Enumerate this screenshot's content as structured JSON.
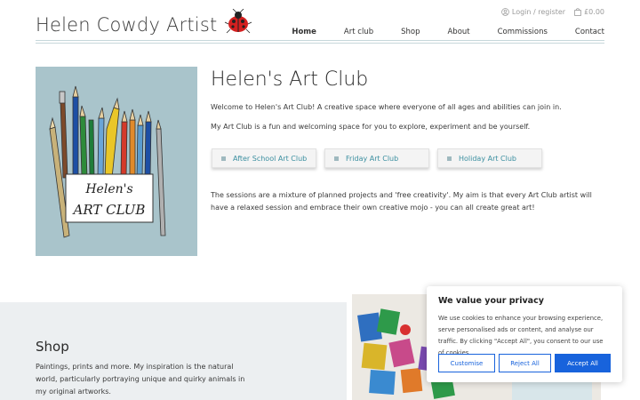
{
  "header": {
    "logo_text": "Helen Cowdy Artist",
    "login_label": "Login / register",
    "cart_label": "£0.00",
    "nav": [
      "Home",
      "Art club",
      "Shop",
      "About",
      "Commissions",
      "Contact"
    ]
  },
  "hero": {
    "image_caption_line1": "Helen's",
    "image_caption_line2": "ART CLUB",
    "title": "Helen's Art Club",
    "para1": "Welcome to Helen's Art Club! A creative space where everyone of all ages and abilities can join in.",
    "para2": "My Art Club is a fun and welcoming space for you to explore, experiment and be yourself.",
    "buttons": [
      "After School Art Club",
      "Friday Art Club",
      "Holiday Art Club"
    ],
    "para3": "The sessions are a mixture of planned projects and 'free creativity'. My aim is that every Art Club artist will have a relaxed session and embrace their own creative mojo - you can all create great art!"
  },
  "shop": {
    "title": "Shop",
    "text": "Paintings, prints and more. My inspiration is the natural world, particularly portraying unique and quirky animals in my original artworks."
  },
  "cookie": {
    "title": "We value your privacy",
    "text": "We use cookies to enhance your browsing experience, serve personalised ads or content, and analyse our traffic. By clicking \"Accept All\", you consent to our use of cookies.",
    "customise": "Customise",
    "reject": "Reject All",
    "accept": "Accept All"
  },
  "colors": {
    "accent_teal": "#3b8fa0",
    "hero_bg": "#a9c4cb",
    "cookie_blue": "#1863dc"
  }
}
